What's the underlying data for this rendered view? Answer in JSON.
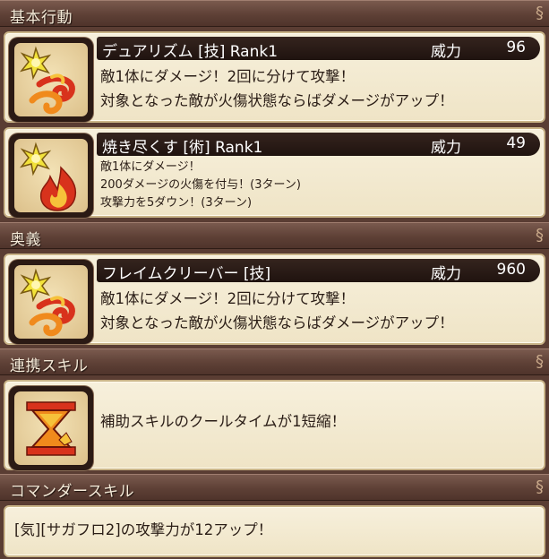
{
  "sections": {
    "basic": "基本行動",
    "secret": "奥義",
    "link": "連携スキル",
    "commander": "コマンダースキル"
  },
  "skills": [
    {
      "name": "デュアリズム [技]  Rank1",
      "power_label": "威力",
      "power": "96",
      "icon": "spark-swirl-icon",
      "lines": [
        "敵1体にダメージ！2回に分けて攻撃！",
        "対象となった敵が火傷状態ならばダメージがアップ！"
      ]
    },
    {
      "name": "焼き尽くす [術]  Rank1",
      "power_label": "威力",
      "power": "49",
      "icon": "spark-flame-icon",
      "lines": [
        "敵1体にダメージ！",
        "200ダメージの火傷を付与！(3ターン)",
        "攻撃力を5ダウン！(3ターン)"
      ]
    },
    {
      "name": "フレイムクリーバー [技]",
      "power_label": "威力",
      "power": "960",
      "icon": "spark-swirl-icon",
      "lines": [
        "敵1体にダメージ！2回に分けて攻撃！",
        "対象となった敵が火傷状態ならばダメージがアップ！"
      ]
    }
  ],
  "link_skill": {
    "icon": "hourglass-icon",
    "text": "補助スキルのクールタイムが1短縮！"
  },
  "commander_skill": {
    "text": "[気][サガフロ2]の攻撃力が12アップ！"
  },
  "colors": {
    "header": "#5e4036",
    "card": "#f3e9cf",
    "title_bar": "#241611",
    "fire_red": "#d8321c",
    "fire_orange": "#f08a1c",
    "spark_yellow": "#f2e23a"
  }
}
